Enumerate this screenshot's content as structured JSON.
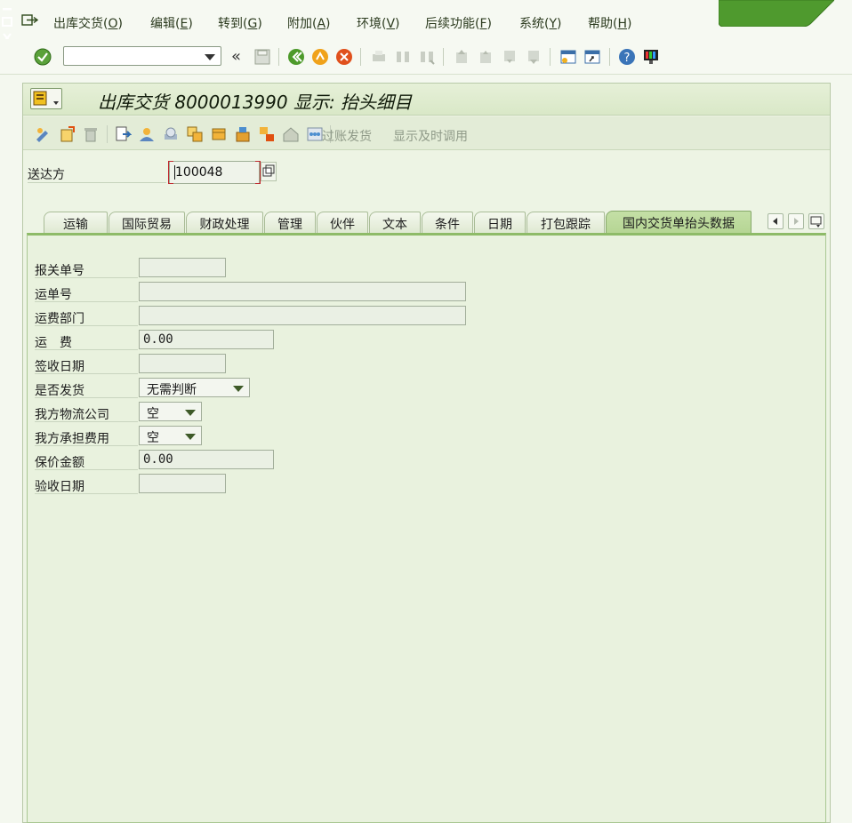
{
  "menu": {
    "items": [
      {
        "label": "出库交货",
        "key": "O"
      },
      {
        "label": "编辑",
        "key": "E"
      },
      {
        "label": "转到",
        "key": "G"
      },
      {
        "label": "附加",
        "key": "A"
      },
      {
        "label": "环境",
        "key": "V"
      },
      {
        "label": "后续功能",
        "key": "F"
      },
      {
        "label": "系统",
        "key": "Y"
      },
      {
        "label": "帮助",
        "key": "H"
      }
    ]
  },
  "toolbar": {
    "command_field_value": "",
    "back_glyph": "«"
  },
  "title": {
    "text": "出库交货 8000013990 显示: 抬头细目"
  },
  "appbar": {
    "post_goods_issue": "过账发货",
    "display_timely_call": "显示及时调用"
  },
  "shipto": {
    "label": "送达方",
    "value": "100048"
  },
  "tabs": [
    "运输",
    "国际贸易",
    "财政处理",
    "管理",
    "伙伴",
    "文本",
    "条件",
    "日期",
    "打包跟踪",
    "国内交货单抬头数据"
  ],
  "active_tab_index": 9,
  "form": {
    "customs_no": {
      "label": "报关单号",
      "value": ""
    },
    "waybill_no": {
      "label": "运单号",
      "value": ""
    },
    "freight_dept": {
      "label": "运费部门",
      "value": ""
    },
    "freight": {
      "label": "运　费",
      "value": "0.00"
    },
    "sign_date": {
      "label": "签收日期",
      "value": ""
    },
    "ship_flag": {
      "label": "是否发货",
      "value": "无需判断"
    },
    "our_logistics": {
      "label": "我方物流公司",
      "value": "空"
    },
    "our_cost": {
      "label": "我方承担费用",
      "value": "空"
    },
    "insured_amount": {
      "label": "保价金额",
      "value": "0.00"
    },
    "accept_date": {
      "label": "验收日期",
      "value": ""
    }
  },
  "colors": {
    "accent_green": "#4f9a2e",
    "tab_active": "#b5d593",
    "panel_bg": "#e9f2de"
  }
}
